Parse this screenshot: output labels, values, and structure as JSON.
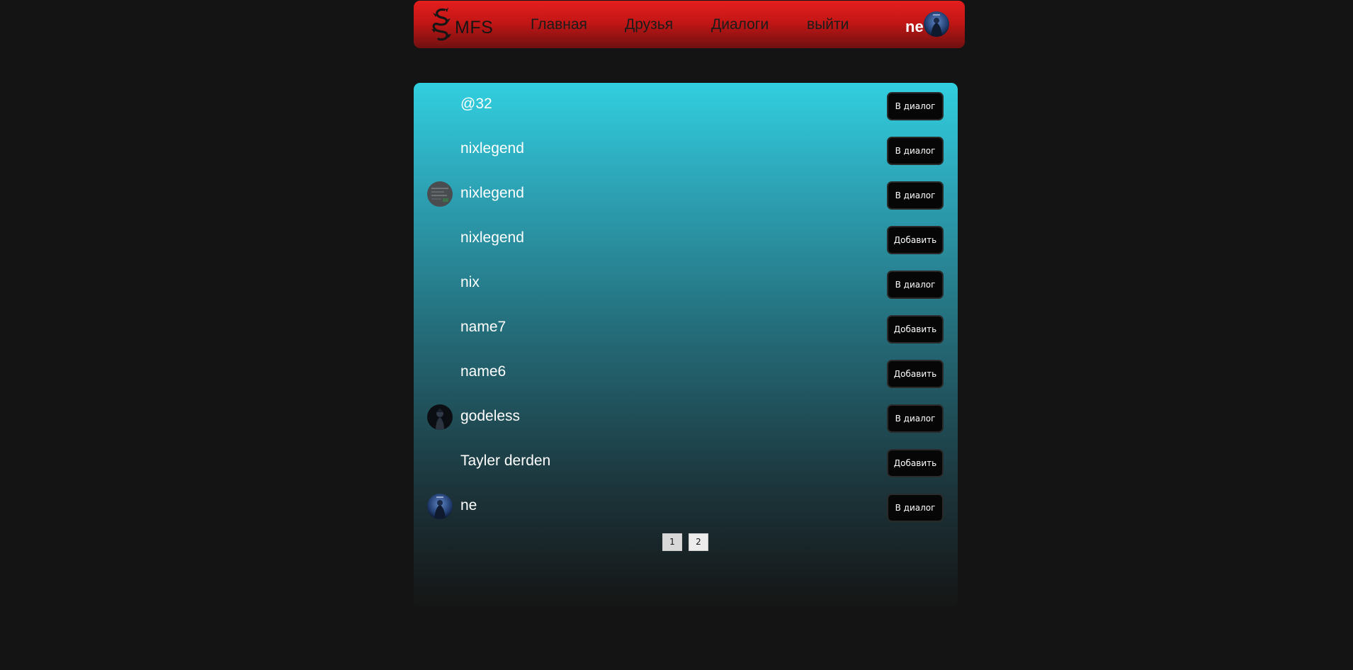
{
  "header": {
    "logo_text": "MFS",
    "nav": [
      "Главная",
      "Друзья",
      "Диалоги",
      "выйти"
    ],
    "user_name": "ne"
  },
  "users": [
    {
      "name": "@32",
      "action": "В диалог",
      "avatar": "none"
    },
    {
      "name": "nixlegend",
      "action": "В диалог",
      "avatar": "none"
    },
    {
      "name": "nixlegend",
      "action": "В диалог",
      "avatar": "gray-screenshot"
    },
    {
      "name": "nixlegend",
      "action": "Добавить",
      "avatar": "none"
    },
    {
      "name": "nix",
      "action": "В диалог",
      "avatar": "none"
    },
    {
      "name": "name7",
      "action": "Добавить",
      "avatar": "none"
    },
    {
      "name": "name6",
      "action": "Добавить",
      "avatar": "none"
    },
    {
      "name": "godeless",
      "action": "В диалог",
      "avatar": "dark-figure"
    },
    {
      "name": "Tayler derden",
      "action": "Добавить",
      "avatar": "none"
    },
    {
      "name": "ne",
      "action": "В диалог",
      "avatar": "blue-night"
    }
  ],
  "pagination": {
    "pages": [
      "1",
      "2"
    ],
    "current": "1"
  },
  "colors": {
    "background": "#141414",
    "header_top": "#e41e1e",
    "header_bottom": "#701010",
    "panel_top": "#31cfe0",
    "panel_bottom": "#151515",
    "button_bg": "#060606"
  }
}
